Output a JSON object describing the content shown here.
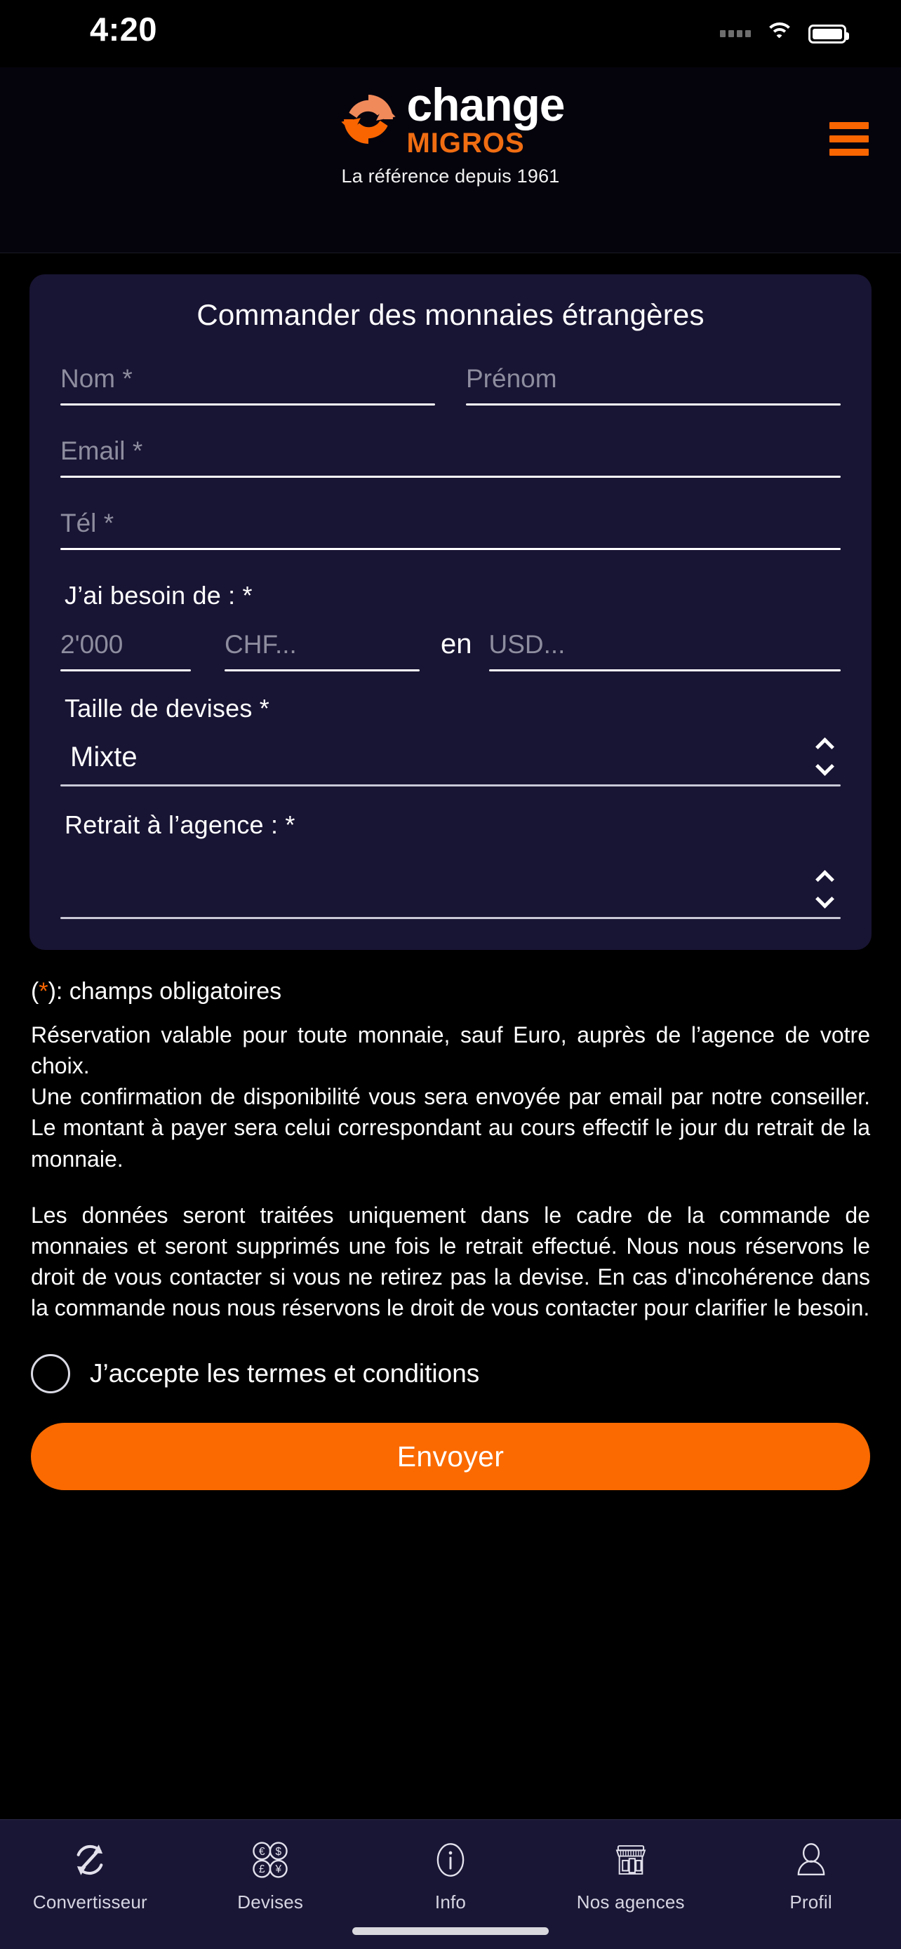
{
  "status_bar": {
    "time": "4:20",
    "icons": [
      "signal-dots-icon",
      "wifi-icon",
      "battery-icon"
    ]
  },
  "header": {
    "logo_icon": "change-migros-circular-arrows-logo",
    "brand_primary": "change",
    "brand_secondary": "MIGROS",
    "tagline": "La référence depuis 1961",
    "menu_icon": "hamburger-menu-icon",
    "menu_color": "#f96500"
  },
  "form": {
    "title": "Commander des monnaies étrangères",
    "last_name": {
      "placeholder": "Nom",
      "required_mark": "*",
      "value": ""
    },
    "first_name": {
      "placeholder": "Prénom",
      "required_mark": "",
      "value": ""
    },
    "email": {
      "placeholder": "Email",
      "required_mark": "*",
      "value": ""
    },
    "phone": {
      "placeholder": "Tél",
      "required_mark": "*",
      "value": ""
    },
    "need_label": "J’ai besoin de : *",
    "amount": {
      "placeholder": "2'000",
      "value": ""
    },
    "currency_from": {
      "placeholder": "CHF...",
      "value": ""
    },
    "in_word": "en",
    "currency_to": {
      "placeholder": "USD...",
      "value": ""
    },
    "denomination_label": "Taille de devises *",
    "denomination_value": "Mixte",
    "branch_label": "Retrait à l’agence : *",
    "branch_value": "",
    "chevron_icon": "chevron-up-down-icon"
  },
  "legal": {
    "required_note_open": "(",
    "required_note_star": "*",
    "required_note_rest": "): champs obligatoires",
    "paragraph_1": "Réservation valable pour toute monnaie, sauf Euro, auprès de l’agence de votre choix.\nUne confirmation de disponibilité vous sera envoyée par email par notre conseiller. Le montant à payer sera celui correspondant au cours effectif le jour du retrait de la monnaie.",
    "paragraph_2": "Les données seront traitées uniquement dans le cadre de la commande de monnaies et seront supprimés une fois le retrait effectué. Nous nous réservons le droit de vous contacter si vous ne retirez pas la devise. En cas d'incohérence dans la commande nous nous réservons le droit de vous contacter pour clarifier le besoin."
  },
  "consent": {
    "label": "J’accepte les termes et conditions",
    "checked": false,
    "checkbox_icon": "circle-checkbox-icon"
  },
  "submit": {
    "label": "Envoyer",
    "color": "#fb6a00"
  },
  "tabbar": {
    "items": [
      {
        "label": "Convertisseur",
        "icon": "circular-arrows-icon"
      },
      {
        "label": "Devises",
        "icon": "currency-coins-icon"
      },
      {
        "label": "Info",
        "icon": "info-circle-icon"
      },
      {
        "label": "Nos agences",
        "icon": "storefront-icon"
      },
      {
        "label": "Profil",
        "icon": "person-icon"
      }
    ]
  },
  "colors": {
    "background": "#000000",
    "card": "#181433",
    "accent": "#fb6a00",
    "tabbar": "#191635"
  }
}
